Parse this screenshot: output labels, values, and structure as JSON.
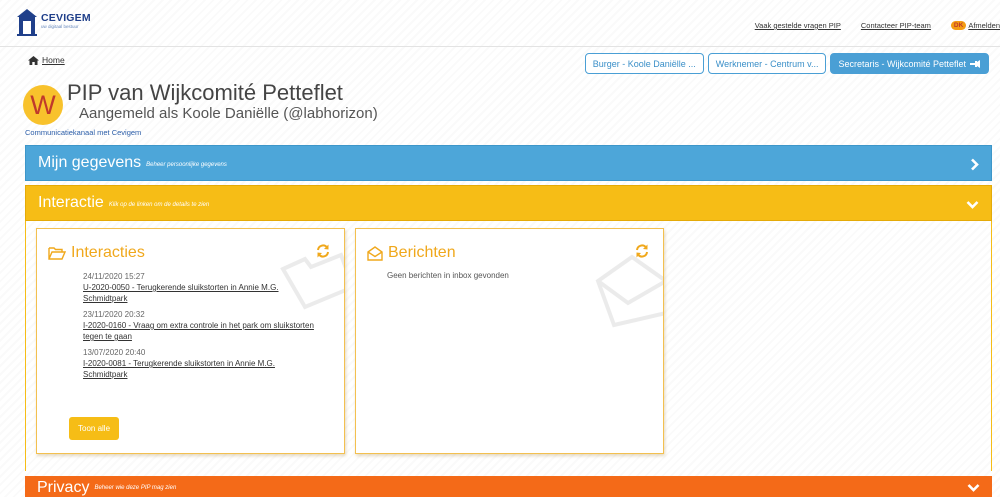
{
  "header": {
    "logo_name": "CEVIGEM",
    "logo_tagline": "uw digitaal bestuur",
    "links": [
      "Vaak gestelde vragen PIP",
      "Contacteer PIP-team"
    ],
    "user_initials": "DK",
    "logout_label": "Afmelden"
  },
  "breadcrumb": {
    "home_label": "Home"
  },
  "role_tabs": [
    {
      "label": "Burger - Koole Daniëlle ..."
    },
    {
      "label": "Werknemer - Centrum v..."
    },
    {
      "label": "Secretaris - Wijkcomité Petteflet"
    }
  ],
  "title": {
    "avatar_letter": "W",
    "main": "PIP van Wijkcomité Petteflet",
    "sub": "Aangemeld als Koole Daniëlle (@labhorizon)",
    "comm_link": "Communicatiekanaal met Cevigem"
  },
  "panels": {
    "gegevens": {
      "title": "Mijn gegevens",
      "subtitle": "Beheer persoonlijke gegevens"
    },
    "interactie": {
      "title": "Interactie",
      "subtitle": "Klik op de linken om de details te zien"
    },
    "privacy": {
      "title": "Privacy",
      "subtitle": "Beheer wie deze PIP mag zien"
    }
  },
  "interacties": {
    "title": "Interacties",
    "items": [
      {
        "date": "24/11/2020 15:27",
        "line1": "U-2020-0050 - Terugkerende sluikstorten in Annie M.G.",
        "line2": "Schmidtpark"
      },
      {
        "date": "23/11/2020 20:32",
        "line1": "I-2020-0160 - Vraag om extra controle in het park om sluikstorten",
        "line2": "tegen te gaan"
      },
      {
        "date": "13/07/2020 20:40",
        "line1": "I-2020-0081 - Terugkerende sluikstorten in Annie M.G.",
        "line2": "Schmidtpark"
      }
    ],
    "button_label": "Toon alle"
  },
  "berichten": {
    "title": "Berichten",
    "empty": "Geen berichten in inbox gevonden"
  },
  "colors": {
    "blue": "#4da6d9",
    "yellow": "#f6bd16",
    "orange": "#f46a18",
    "card_heading": "#f0a81c"
  }
}
